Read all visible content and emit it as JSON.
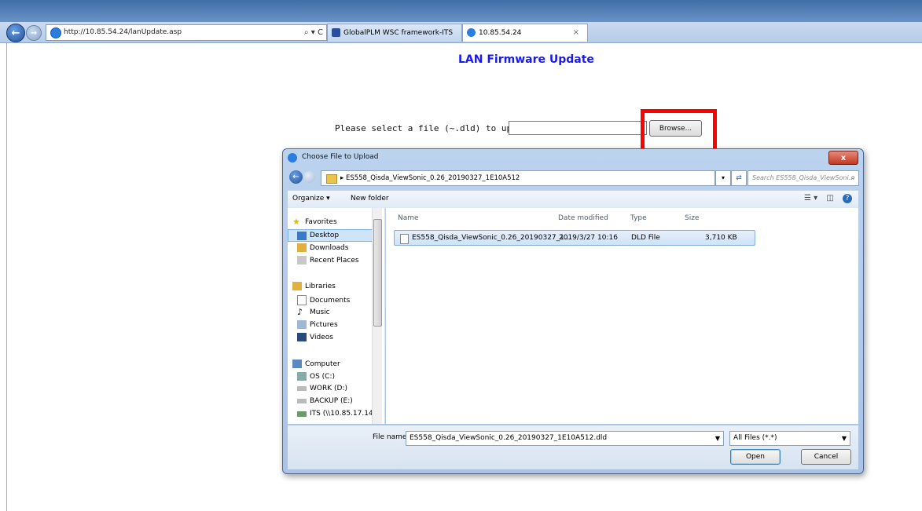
{
  "browser": {
    "url": "http://10.85.54.24/lanUpdate.asp",
    "address_tools": "⌕ ▾ C",
    "tabs": [
      {
        "label": "GlobalPLM WSC framework-ITS"
      },
      {
        "label": "10.85.54.24",
        "close": "×"
      }
    ]
  },
  "page": {
    "title": "LAN Firmware Update",
    "select_label": "Please select a file (~.dld) to update :",
    "file_value": "",
    "browse_label": "Browse..."
  },
  "dialog": {
    "title": "Choose File to Upload",
    "close": "x",
    "path": "▸  ES558_Qisda_ViewSonic_0.26_20190327_1E10A512",
    "search_placeholder": "Search ES558_Qisda_ViewSoni...",
    "toolbar": {
      "organize": "Organize ▾",
      "new_folder": "New folder"
    },
    "nav": {
      "favorites": "Favorites",
      "desktop": "Desktop",
      "downloads": "Downloads",
      "recent": "Recent Places",
      "libraries": "Libraries",
      "documents": "Documents",
      "music": "Music",
      "pictures": "Pictures",
      "videos": "Videos",
      "computer": "Computer",
      "os": "OS (C:)",
      "work": "WORK (D:)",
      "backup": "BACKUP (E:)",
      "its": "ITS (\\\\10.85.17.14"
    },
    "columns": {
      "name": "Name",
      "date": "Date modified",
      "type": "Type",
      "size": "Size"
    },
    "file": {
      "name": "ES558_Qisda_ViewSonic_0.26_20190327_1...",
      "date": "2019/3/27 10:16",
      "type": "DLD File",
      "size": "3,710 KB"
    },
    "filename_label": "File name:",
    "filename_value": "ES558_Qisda_ViewSonic_0.26_20190327_1E10A512.dld",
    "filter_value": "All Files (*.*)",
    "open_label": "Open",
    "cancel_label": "Cancel"
  },
  "colors": {
    "title_blue": "#1a1aee",
    "highlight_red": "#ff0000"
  }
}
